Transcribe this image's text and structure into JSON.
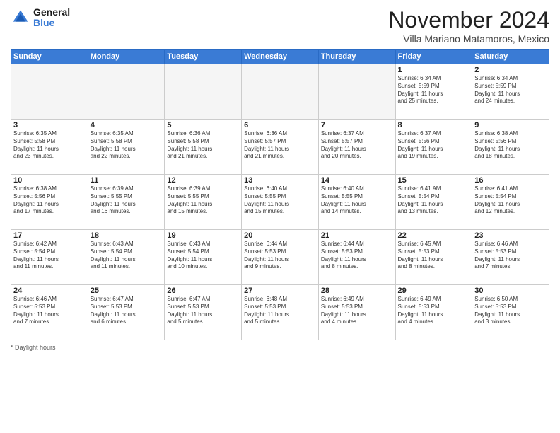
{
  "app": {
    "logo_line1": "General",
    "logo_line2": "Blue"
  },
  "header": {
    "month": "November 2024",
    "location": "Villa Mariano Matamoros, Mexico"
  },
  "days_of_week": [
    "Sunday",
    "Monday",
    "Tuesday",
    "Wednesday",
    "Thursday",
    "Friday",
    "Saturday"
  ],
  "footer": {
    "label": "Daylight hours"
  },
  "weeks": [
    {
      "days": [
        {
          "num": "",
          "info": "",
          "empty": true
        },
        {
          "num": "",
          "info": "",
          "empty": true
        },
        {
          "num": "",
          "info": "",
          "empty": true
        },
        {
          "num": "",
          "info": "",
          "empty": true
        },
        {
          "num": "",
          "info": "",
          "empty": true
        },
        {
          "num": "1",
          "info": "Sunrise: 6:34 AM\nSunset: 5:59 PM\nDaylight: 11 hours\nand 25 minutes."
        },
        {
          "num": "2",
          "info": "Sunrise: 6:34 AM\nSunset: 5:59 PM\nDaylight: 11 hours\nand 24 minutes."
        }
      ]
    },
    {
      "days": [
        {
          "num": "3",
          "info": "Sunrise: 6:35 AM\nSunset: 5:58 PM\nDaylight: 11 hours\nand 23 minutes."
        },
        {
          "num": "4",
          "info": "Sunrise: 6:35 AM\nSunset: 5:58 PM\nDaylight: 11 hours\nand 22 minutes."
        },
        {
          "num": "5",
          "info": "Sunrise: 6:36 AM\nSunset: 5:58 PM\nDaylight: 11 hours\nand 21 minutes."
        },
        {
          "num": "6",
          "info": "Sunrise: 6:36 AM\nSunset: 5:57 PM\nDaylight: 11 hours\nand 21 minutes."
        },
        {
          "num": "7",
          "info": "Sunrise: 6:37 AM\nSunset: 5:57 PM\nDaylight: 11 hours\nand 20 minutes."
        },
        {
          "num": "8",
          "info": "Sunrise: 6:37 AM\nSunset: 5:56 PM\nDaylight: 11 hours\nand 19 minutes."
        },
        {
          "num": "9",
          "info": "Sunrise: 6:38 AM\nSunset: 5:56 PM\nDaylight: 11 hours\nand 18 minutes."
        }
      ]
    },
    {
      "days": [
        {
          "num": "10",
          "info": "Sunrise: 6:38 AM\nSunset: 5:56 PM\nDaylight: 11 hours\nand 17 minutes."
        },
        {
          "num": "11",
          "info": "Sunrise: 6:39 AM\nSunset: 5:55 PM\nDaylight: 11 hours\nand 16 minutes."
        },
        {
          "num": "12",
          "info": "Sunrise: 6:39 AM\nSunset: 5:55 PM\nDaylight: 11 hours\nand 15 minutes."
        },
        {
          "num": "13",
          "info": "Sunrise: 6:40 AM\nSunset: 5:55 PM\nDaylight: 11 hours\nand 15 minutes."
        },
        {
          "num": "14",
          "info": "Sunrise: 6:40 AM\nSunset: 5:55 PM\nDaylight: 11 hours\nand 14 minutes."
        },
        {
          "num": "15",
          "info": "Sunrise: 6:41 AM\nSunset: 5:54 PM\nDaylight: 11 hours\nand 13 minutes."
        },
        {
          "num": "16",
          "info": "Sunrise: 6:41 AM\nSunset: 5:54 PM\nDaylight: 11 hours\nand 12 minutes."
        }
      ]
    },
    {
      "days": [
        {
          "num": "17",
          "info": "Sunrise: 6:42 AM\nSunset: 5:54 PM\nDaylight: 11 hours\nand 11 minutes."
        },
        {
          "num": "18",
          "info": "Sunrise: 6:43 AM\nSunset: 5:54 PM\nDaylight: 11 hours\nand 11 minutes."
        },
        {
          "num": "19",
          "info": "Sunrise: 6:43 AM\nSunset: 5:54 PM\nDaylight: 11 hours\nand 10 minutes."
        },
        {
          "num": "20",
          "info": "Sunrise: 6:44 AM\nSunset: 5:53 PM\nDaylight: 11 hours\nand 9 minutes."
        },
        {
          "num": "21",
          "info": "Sunrise: 6:44 AM\nSunset: 5:53 PM\nDaylight: 11 hours\nand 8 minutes."
        },
        {
          "num": "22",
          "info": "Sunrise: 6:45 AM\nSunset: 5:53 PM\nDaylight: 11 hours\nand 8 minutes."
        },
        {
          "num": "23",
          "info": "Sunrise: 6:46 AM\nSunset: 5:53 PM\nDaylight: 11 hours\nand 7 minutes."
        }
      ]
    },
    {
      "days": [
        {
          "num": "24",
          "info": "Sunrise: 6:46 AM\nSunset: 5:53 PM\nDaylight: 11 hours\nand 7 minutes."
        },
        {
          "num": "25",
          "info": "Sunrise: 6:47 AM\nSunset: 5:53 PM\nDaylight: 11 hours\nand 6 minutes."
        },
        {
          "num": "26",
          "info": "Sunrise: 6:47 AM\nSunset: 5:53 PM\nDaylight: 11 hours\nand 5 minutes."
        },
        {
          "num": "27",
          "info": "Sunrise: 6:48 AM\nSunset: 5:53 PM\nDaylight: 11 hours\nand 5 minutes."
        },
        {
          "num": "28",
          "info": "Sunrise: 6:49 AM\nSunset: 5:53 PM\nDaylight: 11 hours\nand 4 minutes."
        },
        {
          "num": "29",
          "info": "Sunrise: 6:49 AM\nSunset: 5:53 PM\nDaylight: 11 hours\nand 4 minutes."
        },
        {
          "num": "30",
          "info": "Sunrise: 6:50 AM\nSunset: 5:53 PM\nDaylight: 11 hours\nand 3 minutes."
        }
      ]
    }
  ]
}
